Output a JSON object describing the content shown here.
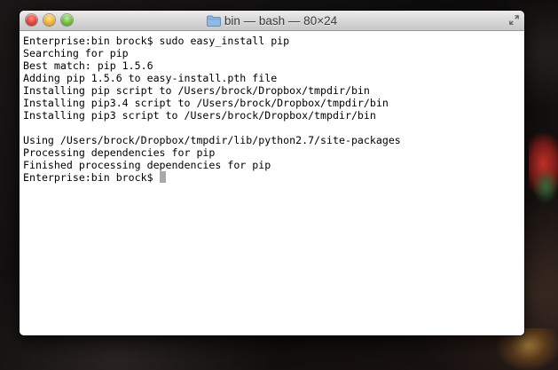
{
  "window": {
    "title": "bin — bash — 80×24"
  },
  "terminal": {
    "lines": [
      "Enterprise:bin brock$ sudo easy_install pip",
      "Searching for pip",
      "Best match: pip 1.5.6",
      "Adding pip 1.5.6 to easy-install.pth file",
      "Installing pip script to /Users/brock/Dropbox/tmpdir/bin",
      "Installing pip3.4 script to /Users/brock/Dropbox/tmpdir/bin",
      "Installing pip3 script to /Users/brock/Dropbox/tmpdir/bin",
      "",
      "Using /Users/brock/Dropbox/tmpdir/lib/python2.7/site-packages",
      "Processing dependencies for pip",
      "Finished processing dependencies for pip"
    ],
    "prompt": "Enterprise:bin brock$"
  },
  "colors": {
    "text": "#000000",
    "background": "#ffffff",
    "cursor": "#a9a9a9",
    "close_button": "#e0443a",
    "minimize_button": "#f2b030",
    "zoom_button": "#6cbf3a"
  },
  "icons": {
    "title": "folder-icon",
    "fullscreen": "fullscreen-arrows-icon"
  }
}
